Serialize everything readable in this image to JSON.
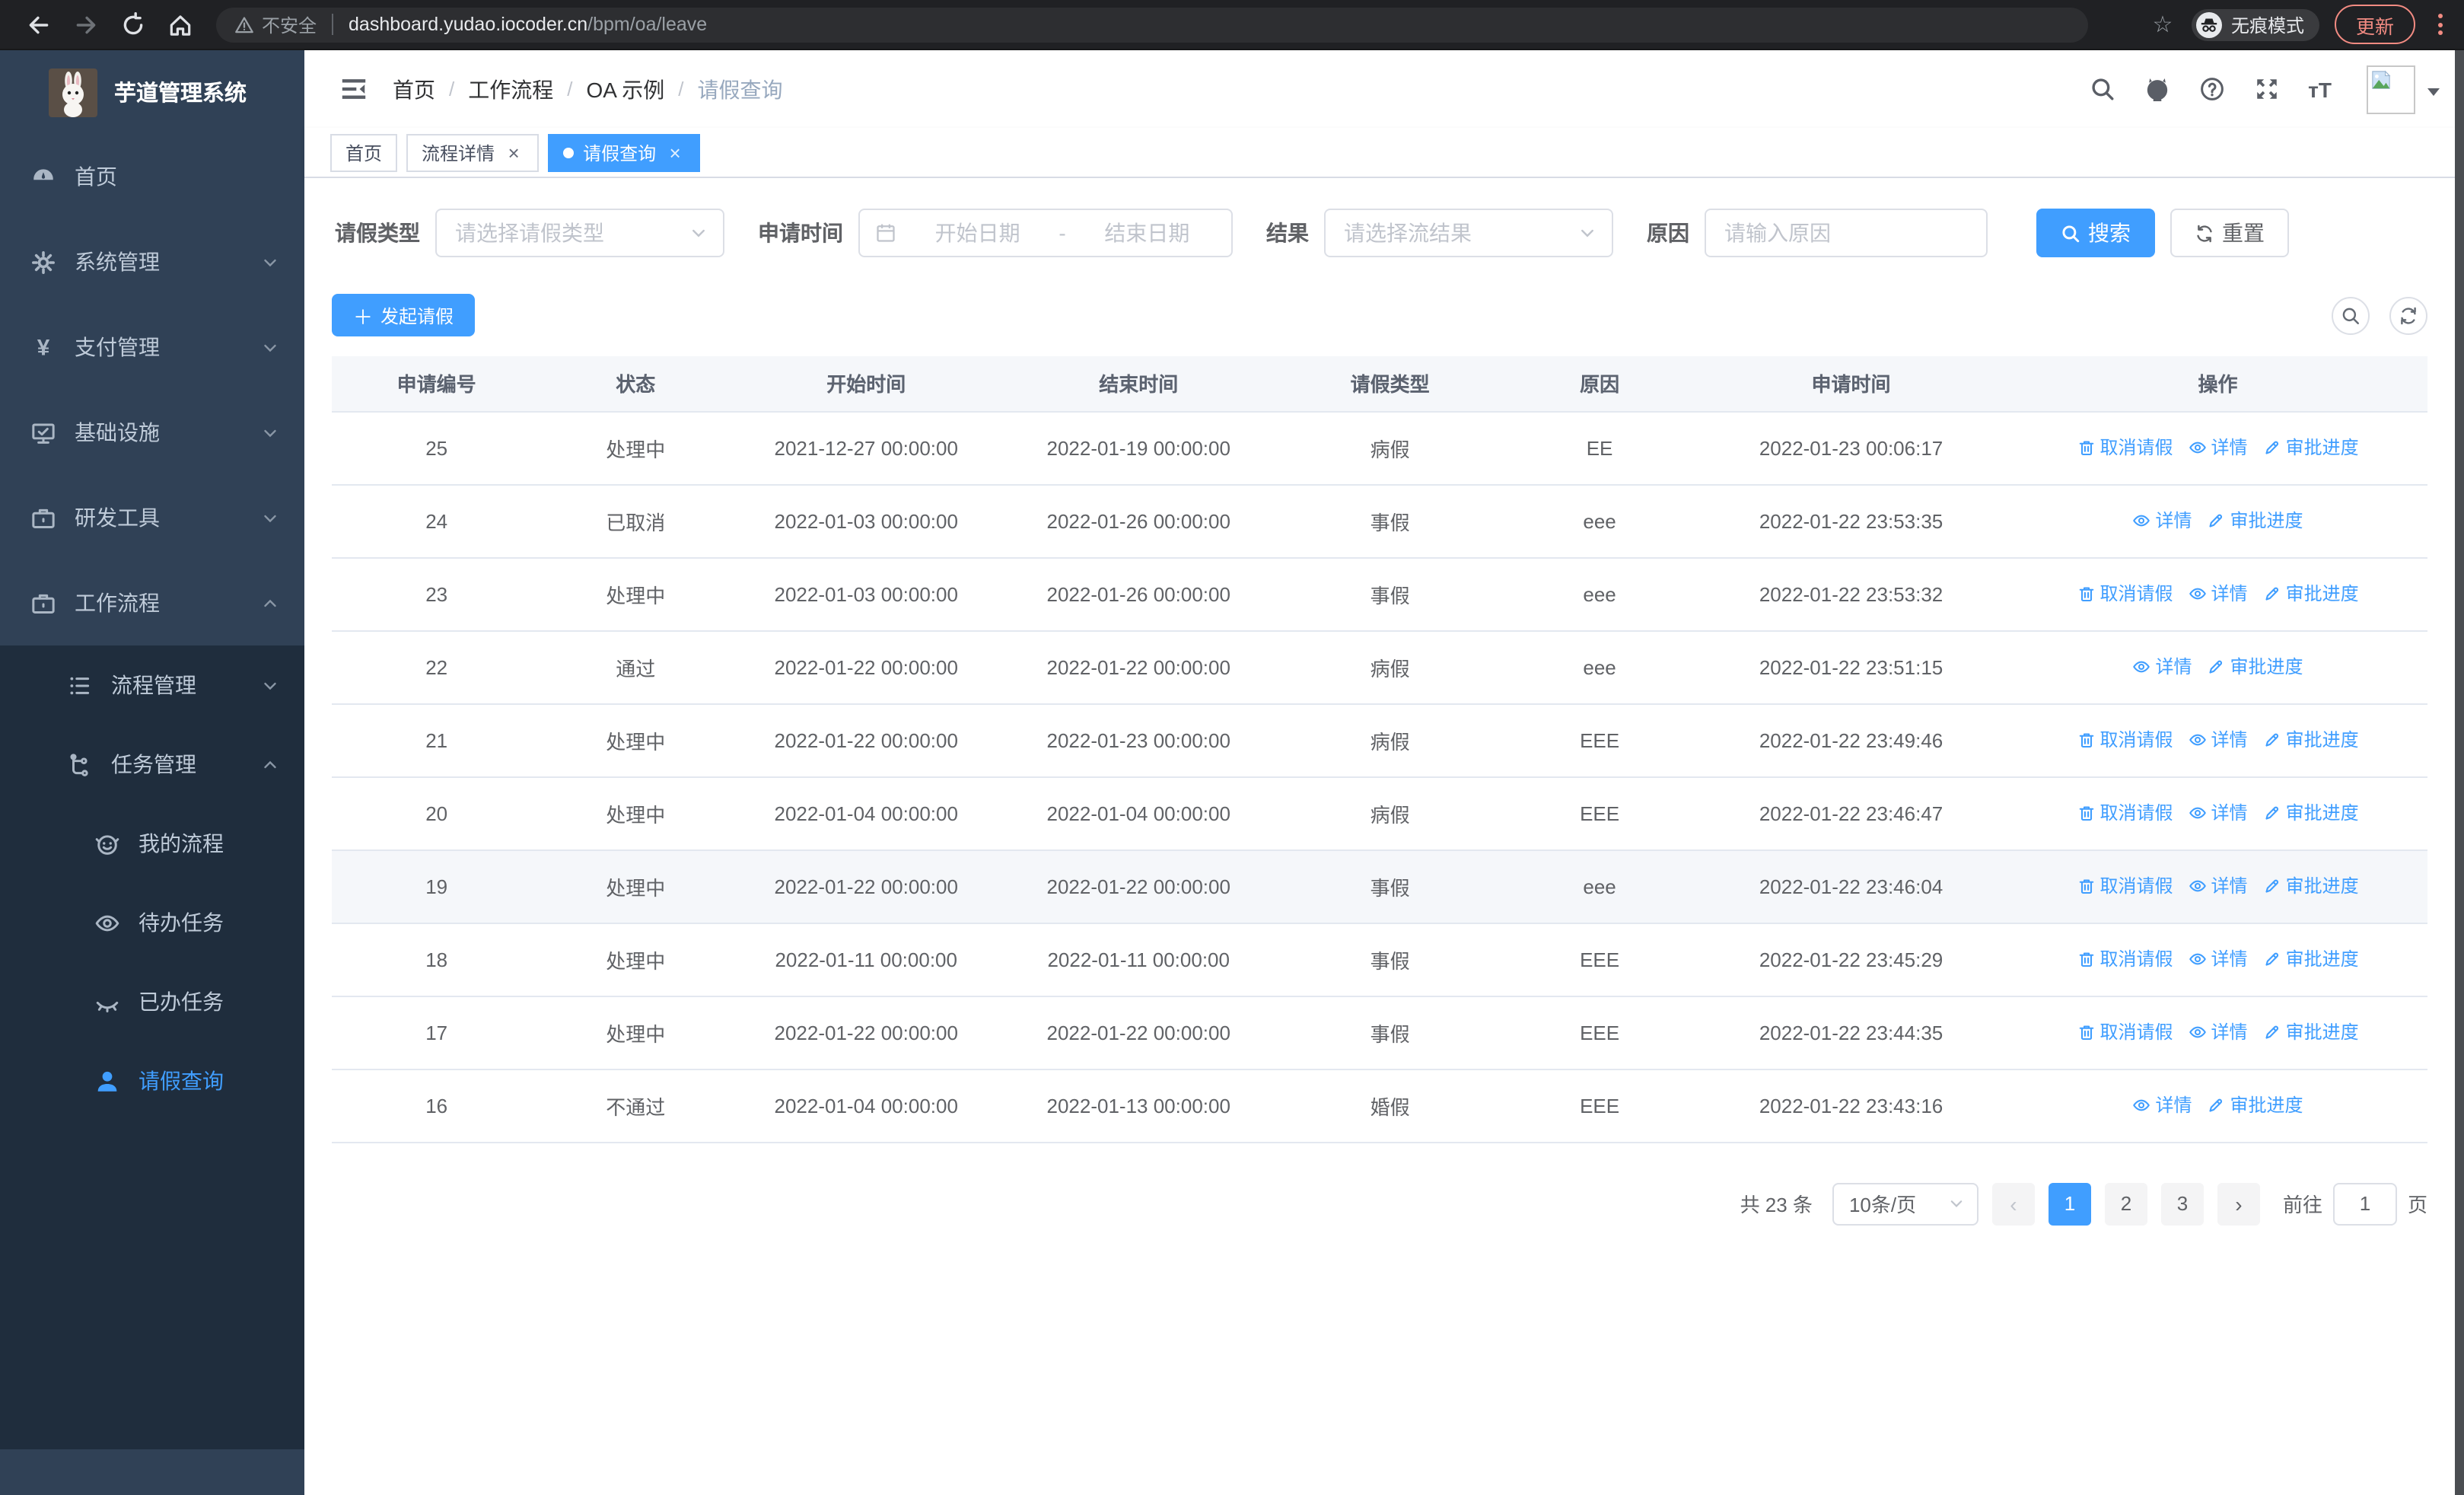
{
  "browser": {
    "security_label": "不安全",
    "url_host": "dashboard.yudao.iocoder.cn",
    "url_path": "/bpm/oa/leave",
    "incognito_label": "无痕模式",
    "update_label": "更新"
  },
  "colors": {
    "accent": "#409eff",
    "sidebar_bg": "#304156",
    "submenu_bg": "#1f2d3d",
    "chrome_bg": "#202124",
    "update_accent": "#f28b82"
  },
  "sidebar": {
    "app_title": "芋道管理系统",
    "items": [
      {
        "name": "home",
        "label": "首页",
        "icon": "gauge",
        "expand": null
      },
      {
        "name": "system",
        "label": "系统管理",
        "icon": "gear",
        "expand": "down"
      },
      {
        "name": "payment",
        "label": "支付管理",
        "icon": "yen",
        "expand": "down"
      },
      {
        "name": "infra",
        "label": "基础设施",
        "icon": "monitor",
        "expand": "down"
      },
      {
        "name": "devtools",
        "label": "研发工具",
        "icon": "briefcase",
        "expand": "down"
      },
      {
        "name": "workflow",
        "label": "工作流程",
        "icon": "briefcase",
        "expand": "up"
      }
    ],
    "workflow_children": [
      {
        "name": "process-mgmt",
        "label": "流程管理",
        "icon": "list",
        "expand": "down"
      },
      {
        "name": "task-mgmt",
        "label": "任务管理",
        "icon": "tree",
        "expand": "up"
      }
    ],
    "task_children": [
      {
        "name": "my-process",
        "label": "我的流程",
        "icon": "face",
        "active": false
      },
      {
        "name": "todo-tasks",
        "label": "待办任务",
        "icon": "eye",
        "active": false
      },
      {
        "name": "done-tasks",
        "label": "已办任务",
        "icon": "eye-closed",
        "active": false
      },
      {
        "name": "leave-query",
        "label": "请假查询",
        "icon": "user",
        "active": true
      }
    ]
  },
  "header": {
    "breadcrumb": [
      "首页",
      "工作流程",
      "OA 示例",
      "请假查询"
    ]
  },
  "tabs": [
    {
      "name": "home",
      "label": "首页",
      "closable": false,
      "active": false
    },
    {
      "name": "process-detail",
      "label": "流程详情",
      "closable": true,
      "active": false
    },
    {
      "name": "leave-query",
      "label": "请假查询",
      "closable": true,
      "active": true
    }
  ],
  "filters": {
    "leave_type_label": "请假类型",
    "leave_type_placeholder": "请选择请假类型",
    "apply_time_label": "申请时间",
    "start_date_placeholder": "开始日期",
    "range_separator": "-",
    "end_date_placeholder": "结束日期",
    "result_label": "结果",
    "result_placeholder": "请选择流结果",
    "reason_label": "原因",
    "reason_placeholder": "请输入原因",
    "search_button": "搜索",
    "reset_button": "重置"
  },
  "toolbar": {
    "create_button": "发起请假"
  },
  "table": {
    "columns": [
      "申请编号",
      "状态",
      "开始时间",
      "结束时间",
      "请假类型",
      "原因",
      "申请时间",
      "操作"
    ],
    "action_labels": {
      "cancel": "取消请假",
      "detail": "详情",
      "progress": "审批进度"
    },
    "rows": [
      {
        "id": "25",
        "status": "处理中",
        "start": "2021-12-27 00:00:00",
        "end": "2022-01-19 00:00:00",
        "type": "病假",
        "reason": "EE",
        "applied": "2022-01-23 00:06:17",
        "actions": [
          "cancel",
          "detail",
          "progress"
        ],
        "hover": false
      },
      {
        "id": "24",
        "status": "已取消",
        "start": "2022-01-03 00:00:00",
        "end": "2022-01-26 00:00:00",
        "type": "事假",
        "reason": "eee",
        "applied": "2022-01-22 23:53:35",
        "actions": [
          "detail",
          "progress"
        ],
        "hover": false
      },
      {
        "id": "23",
        "status": "处理中",
        "start": "2022-01-03 00:00:00",
        "end": "2022-01-26 00:00:00",
        "type": "事假",
        "reason": "eee",
        "applied": "2022-01-22 23:53:32",
        "actions": [
          "cancel",
          "detail",
          "progress"
        ],
        "hover": false
      },
      {
        "id": "22",
        "status": "通过",
        "start": "2022-01-22 00:00:00",
        "end": "2022-01-22 00:00:00",
        "type": "病假",
        "reason": "eee",
        "applied": "2022-01-22 23:51:15",
        "actions": [
          "detail",
          "progress"
        ],
        "hover": false
      },
      {
        "id": "21",
        "status": "处理中",
        "start": "2022-01-22 00:00:00",
        "end": "2022-01-23 00:00:00",
        "type": "病假",
        "reason": "EEE",
        "applied": "2022-01-22 23:49:46",
        "actions": [
          "cancel",
          "detail",
          "progress"
        ],
        "hover": false
      },
      {
        "id": "20",
        "status": "处理中",
        "start": "2022-01-04 00:00:00",
        "end": "2022-01-04 00:00:00",
        "type": "病假",
        "reason": "EEE",
        "applied": "2022-01-22 23:46:47",
        "actions": [
          "cancel",
          "detail",
          "progress"
        ],
        "hover": false
      },
      {
        "id": "19",
        "status": "处理中",
        "start": "2022-01-22 00:00:00",
        "end": "2022-01-22 00:00:00",
        "type": "事假",
        "reason": "eee",
        "applied": "2022-01-22 23:46:04",
        "actions": [
          "cancel",
          "detail",
          "progress"
        ],
        "hover": true
      },
      {
        "id": "18",
        "status": "处理中",
        "start": "2022-01-11 00:00:00",
        "end": "2022-01-11 00:00:00",
        "type": "事假",
        "reason": "EEE",
        "applied": "2022-01-22 23:45:29",
        "actions": [
          "cancel",
          "detail",
          "progress"
        ],
        "hover": false
      },
      {
        "id": "17",
        "status": "处理中",
        "start": "2022-01-22 00:00:00",
        "end": "2022-01-22 00:00:00",
        "type": "事假",
        "reason": "EEE",
        "applied": "2022-01-22 23:44:35",
        "actions": [
          "cancel",
          "detail",
          "progress"
        ],
        "hover": false
      },
      {
        "id": "16",
        "status": "不通过",
        "start": "2022-01-04 00:00:00",
        "end": "2022-01-13 00:00:00",
        "type": "婚假",
        "reason": "EEE",
        "applied": "2022-01-22 23:43:16",
        "actions": [
          "detail",
          "progress"
        ],
        "hover": false
      }
    ]
  },
  "pagination": {
    "total_label": "共 23 条",
    "page_size": "10条/页",
    "pages": [
      "1",
      "2",
      "3"
    ],
    "current_page": "1",
    "goto_label": "前往",
    "goto_value": "1",
    "page_unit": "页"
  }
}
